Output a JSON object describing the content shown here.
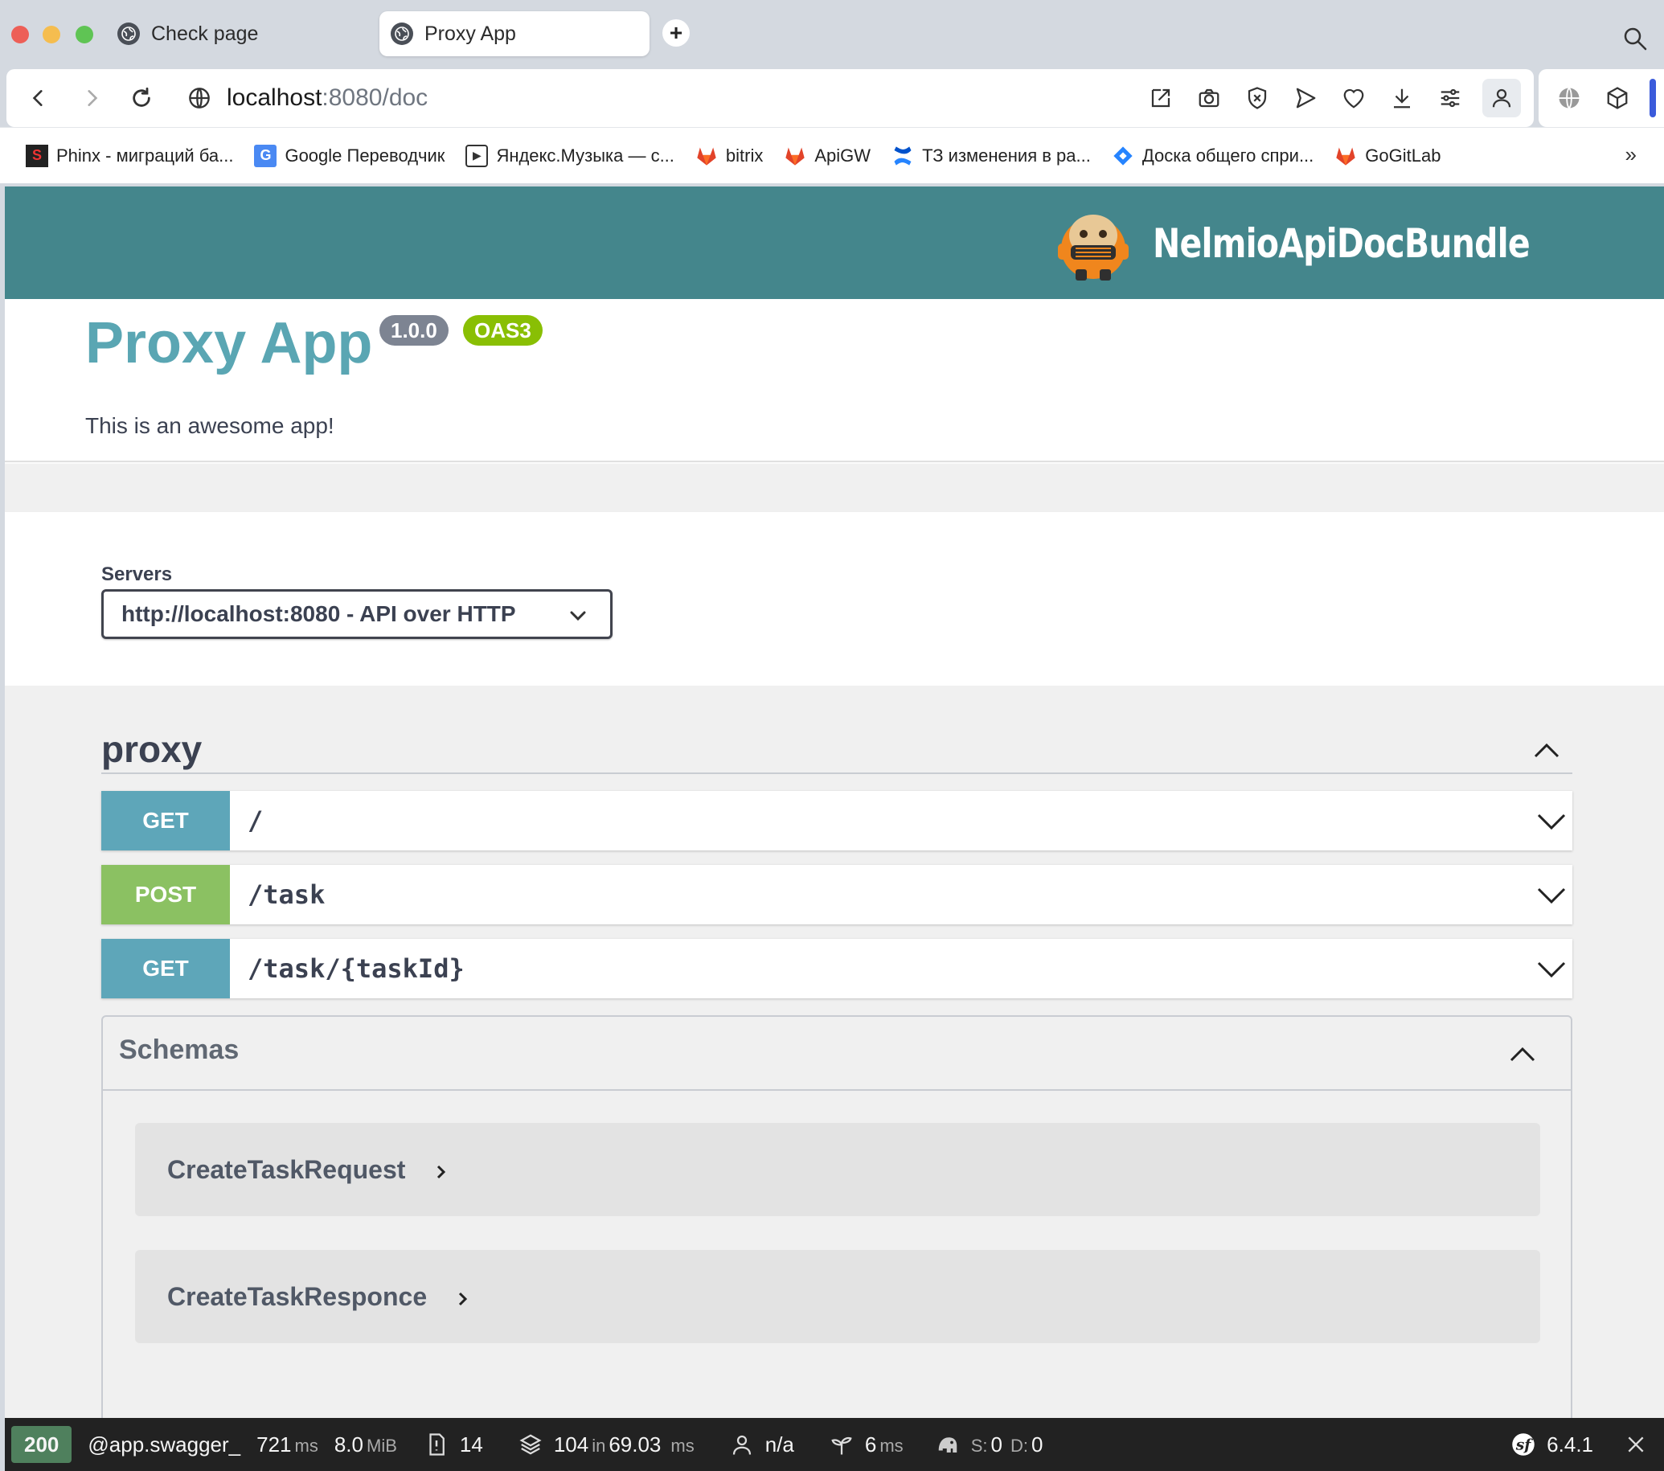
{
  "browser": {
    "tabs": [
      {
        "title": "Check page",
        "active": false
      },
      {
        "title": "Proxy App",
        "active": true
      }
    ],
    "new_tab_label": "+",
    "url_host": "localhost",
    "url_path": ":8080/doc",
    "bookmarks": [
      {
        "label": "Phinx - миграций ба...",
        "icon": "phinx-icon"
      },
      {
        "label": "Google Переводчик",
        "icon": "google-translate-icon"
      },
      {
        "label": "Яндекс.Музыка — с...",
        "icon": "play-icon"
      },
      {
        "label": "bitrix",
        "icon": "gitlab-icon"
      },
      {
        "label": "ApiGW",
        "icon": "gitlab-icon"
      },
      {
        "label": "ТЗ изменения в ра...",
        "icon": "confluence-icon"
      },
      {
        "label": "Доска общего спри...",
        "icon": "jira-icon"
      },
      {
        "label": "GoGitLab",
        "icon": "gitlab-icon"
      }
    ],
    "bookmarks_more": "»"
  },
  "header": {
    "logo_text": "NelmioApiDocBundle",
    "color": "#44868c"
  },
  "info": {
    "title": "Proxy App",
    "version": "1.0.0",
    "oas_badge": "OAS3",
    "description": "This is an awesome app!"
  },
  "servers": {
    "label": "Servers",
    "selected": "http://localhost:8080 - API over HTTP"
  },
  "tag": {
    "name": "proxy",
    "expanded": true
  },
  "operations": [
    {
      "method": "GET",
      "path": "/",
      "color": "#5ea6b9"
    },
    {
      "method": "POST",
      "path": "/task",
      "color": "#8bc162"
    },
    {
      "method": "GET",
      "path": "/task/{taskId}",
      "color": "#5ea6b9"
    }
  ],
  "schemas": {
    "title": "Schemas",
    "items": [
      "CreateTaskRequest",
      "CreateTaskResponce"
    ]
  },
  "profiler": {
    "status": "200",
    "route": "@app.swagger_",
    "time": "721",
    "time_unit": "ms",
    "memory": "8.0",
    "memory_unit": "MiB",
    "logs": "14",
    "events": "104",
    "events_in": "in",
    "events_time": "69.03",
    "events_unit": "ms",
    "user": "n/a",
    "twig_time": "6",
    "twig_unit": "ms",
    "db_s_label": "S:",
    "db_s": "0",
    "db_d_label": "D:",
    "db_d": "0",
    "symfony_version": "6.4.1",
    "status_color": "#4f805d"
  }
}
